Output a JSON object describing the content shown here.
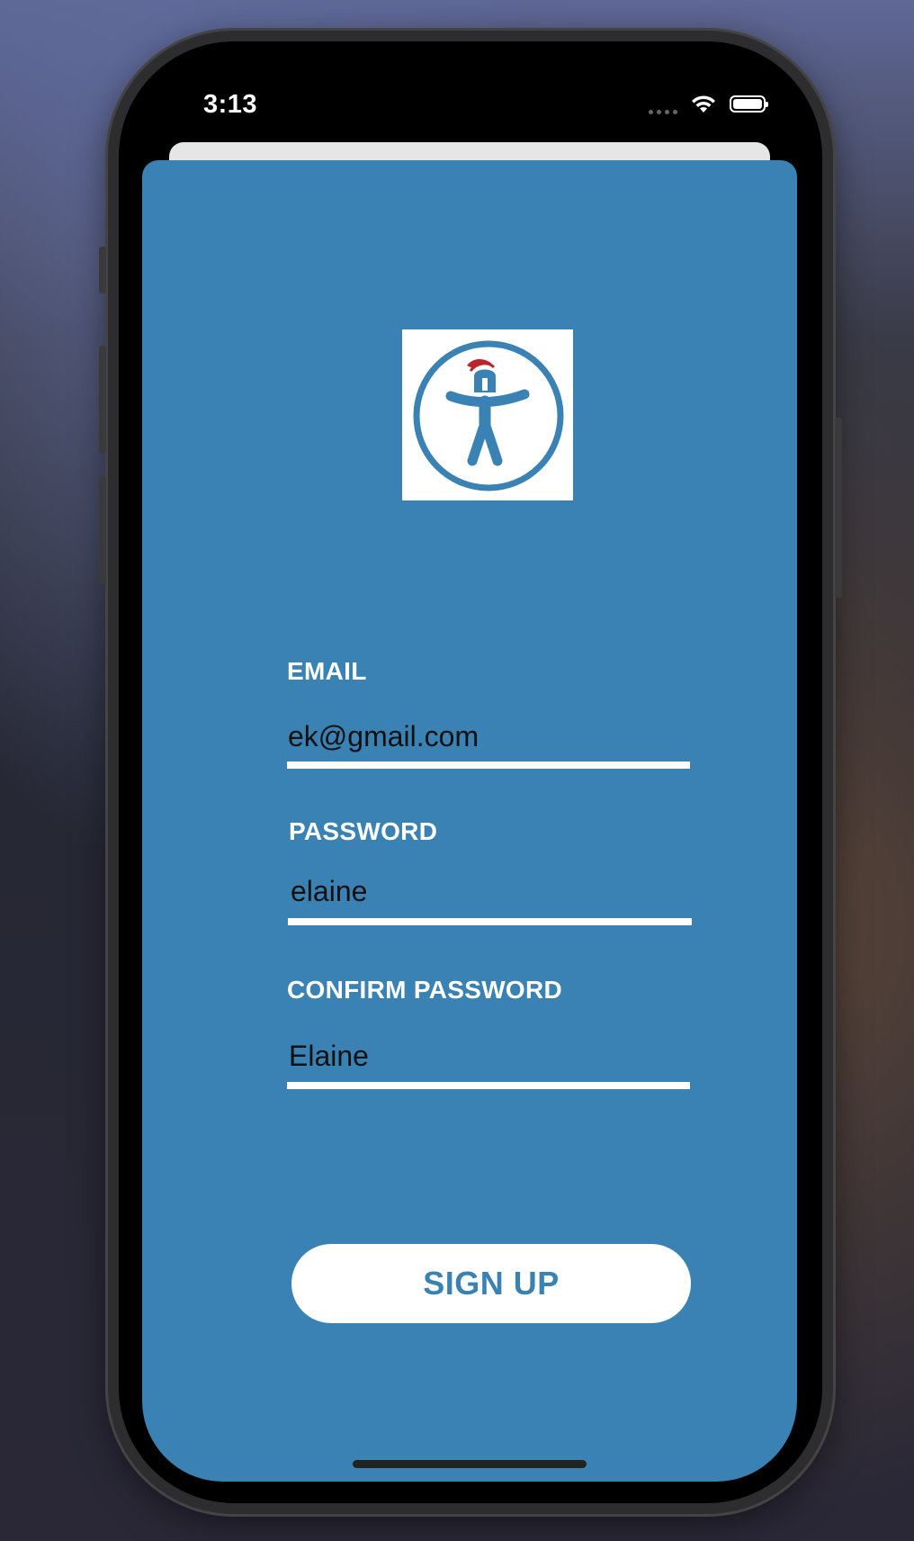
{
  "status_bar": {
    "time": "3:13",
    "icons": [
      "cellular-signal-icon",
      "wifi-icon",
      "battery-icon"
    ]
  },
  "logo": {
    "icon": "accessibility-figure-with-helmet-icon",
    "colors": {
      "ring": "#3a82b3",
      "plume": "#b8262c"
    }
  },
  "form": {
    "email": {
      "label": "EMAIL",
      "value": "ek@gmail.com"
    },
    "password": {
      "label": "PASSWORD",
      "value": "elaine"
    },
    "confirm_password": {
      "label": "CONFIRM PASSWORD",
      "value": "Elaine"
    }
  },
  "actions": {
    "signup_label": "SIGN UP"
  },
  "colors": {
    "sheet_background": "#3a82b3",
    "button_background": "#ffffff",
    "button_text": "#3a82b3",
    "label_text": "#ffffff",
    "value_text": "#111111"
  }
}
